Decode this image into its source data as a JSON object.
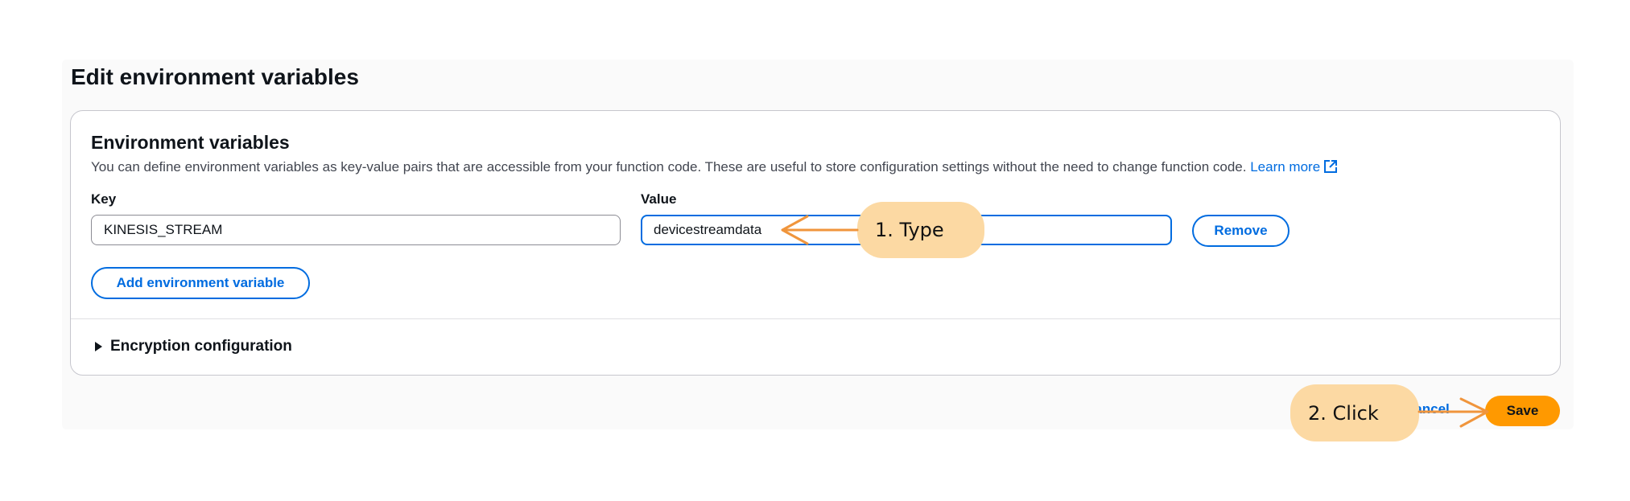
{
  "page": {
    "title": "Edit environment variables"
  },
  "section": {
    "title": "Environment variables",
    "description": "You can define environment variables as key-value pairs that are accessible from your function code. These are useful to store configuration settings without the need to change function code.",
    "learn_more_label": "Learn more"
  },
  "fields": {
    "key_label": "Key",
    "value_label": "Value",
    "key_value": "KINESIS_STREAM",
    "value_value": "devicestreamdata"
  },
  "buttons": {
    "remove_label": "Remove",
    "add_label": "Add environment variable",
    "cancel_label": "Cancel",
    "save_label": "Save"
  },
  "encryption": {
    "label": "Encryption configuration",
    "expanded": false
  },
  "annotations": {
    "step1_label": "1. Type",
    "step2_label": "2. Click",
    "color": "#fcd9a3",
    "arrow_color": "#f0953c"
  },
  "colors": {
    "accent": "#006ce0",
    "primary_button": "#ff9900"
  },
  "icons": {
    "learn_more": "external-link-icon",
    "expander": "caret-right-icon"
  }
}
